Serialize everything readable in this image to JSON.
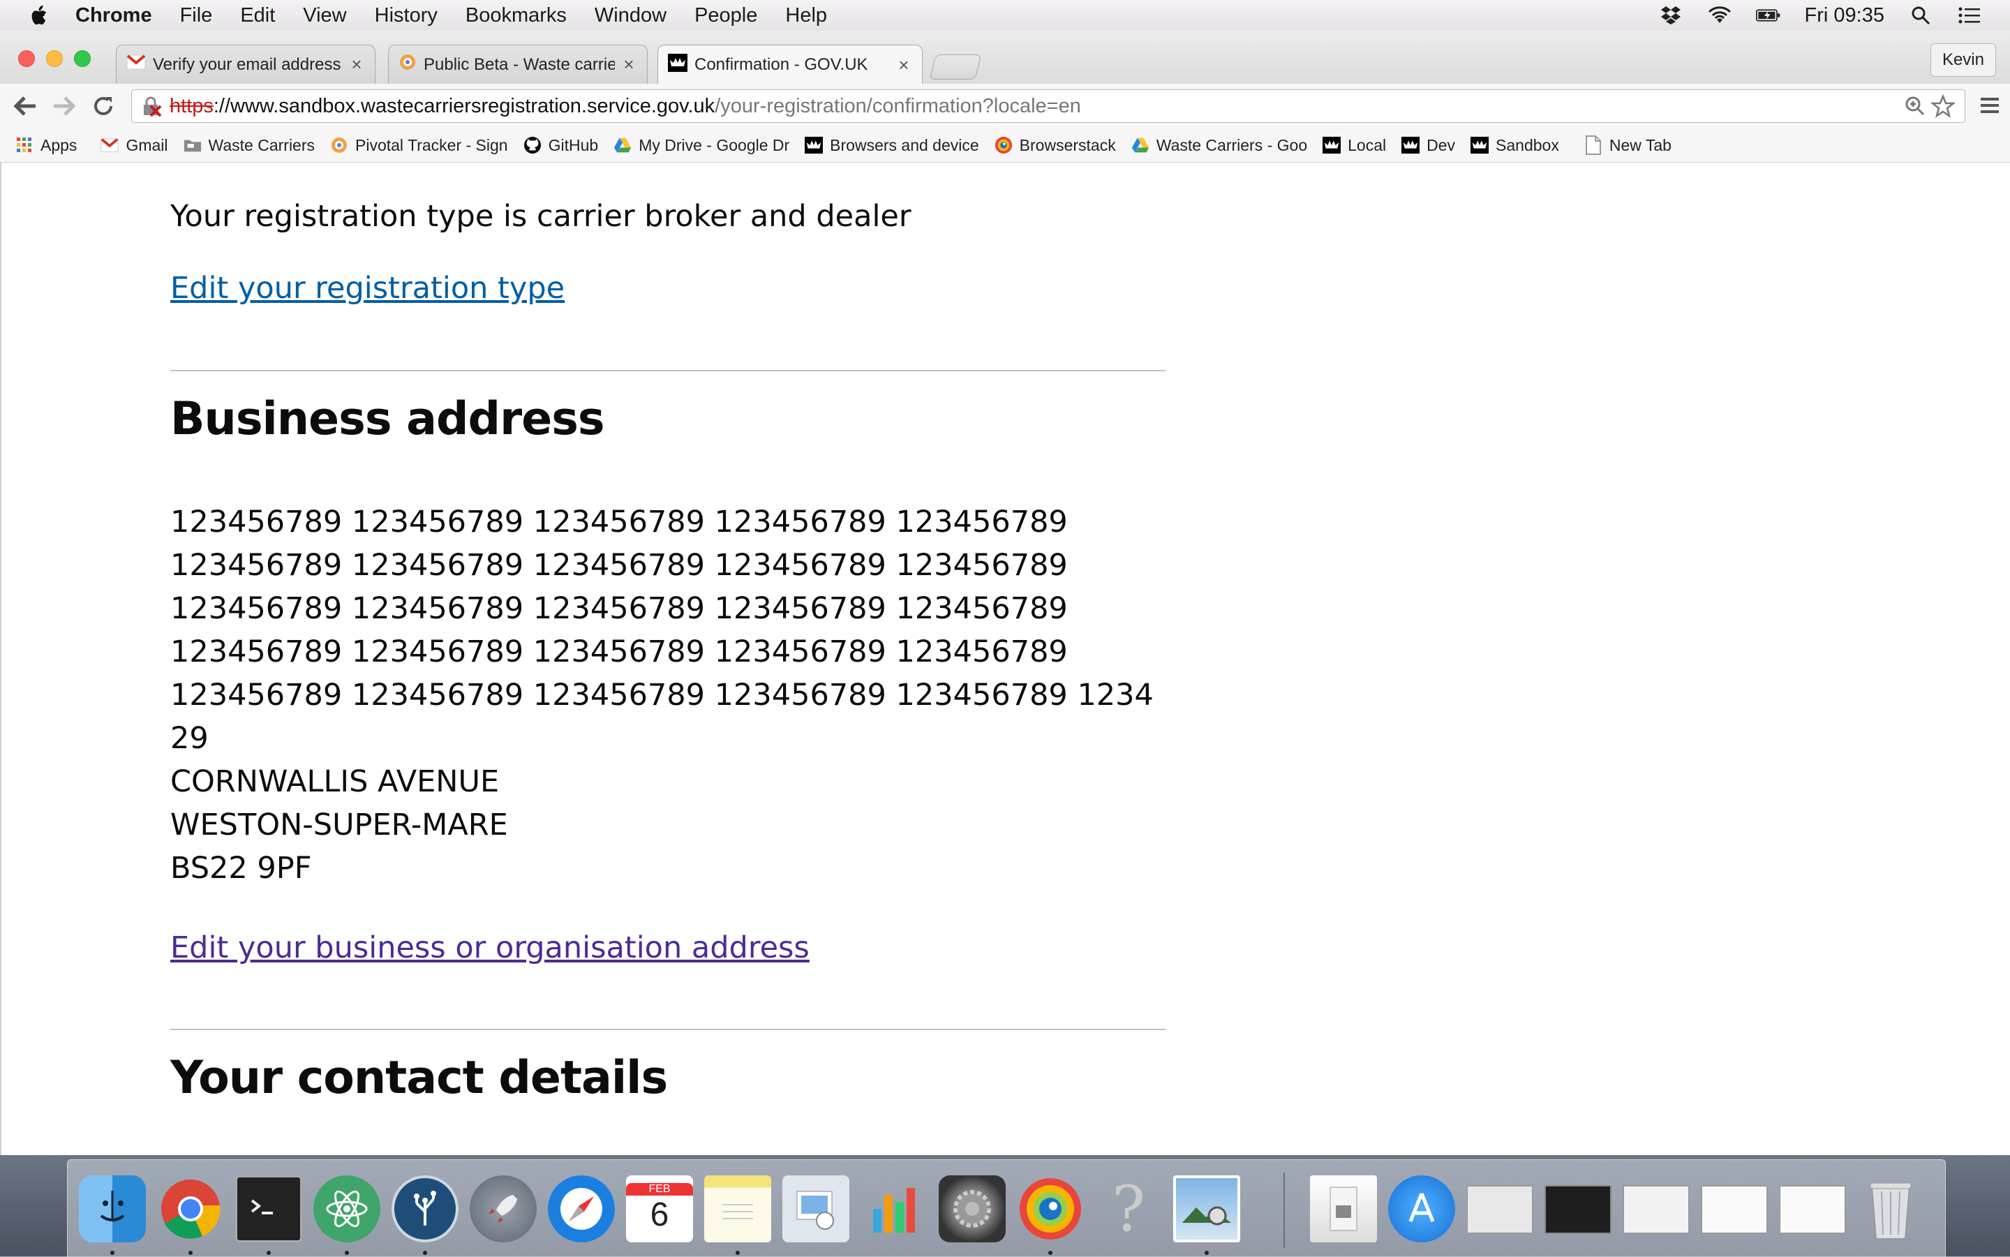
{
  "menubar": {
    "app_name": "Chrome",
    "items": [
      "File",
      "Edit",
      "View",
      "History",
      "Bookmarks",
      "Window",
      "People",
      "Help"
    ],
    "clock": "Fri 09:35"
  },
  "tabs": [
    {
      "title": "Verify your email address -",
      "icon": "gmail-icon",
      "active": false
    },
    {
      "title": "Public Beta - Waste carrier",
      "icon": "pivotal-tracker-icon",
      "active": false
    },
    {
      "title": "Confirmation - GOV.UK",
      "icon": "gov-uk-crown-icon",
      "active": true
    }
  ],
  "tab_close_glyph": "×",
  "profile_name": "Kevin",
  "address_bar": {
    "scheme": "https",
    "host": "://www.sandbox.wastecarriersregistration.service.gov.uk",
    "path": "/your-registration/confirmation?locale=en"
  },
  "bookmarks": [
    {
      "label": "Apps",
      "icon": "apps-grid-icon"
    },
    {
      "label": "Gmail",
      "icon": "gmail-icon"
    },
    {
      "label": "Waste Carriers",
      "icon": "folder-icon"
    },
    {
      "label": "Pivotal Tracker - Sign",
      "icon": "pivotal-tracker-icon"
    },
    {
      "label": "GitHub",
      "icon": "github-icon"
    },
    {
      "label": "My Drive - Google Dr",
      "icon": "google-drive-icon"
    },
    {
      "label": "Browsers and device",
      "icon": "gov-uk-crown-icon"
    },
    {
      "label": "Browserstack",
      "icon": "browserstack-icon"
    },
    {
      "label": "Waste Carriers - Goo",
      "icon": "google-drive-icon"
    },
    {
      "label": "Local",
      "icon": "gov-uk-crown-icon"
    },
    {
      "label": "Dev",
      "icon": "gov-uk-crown-icon"
    },
    {
      "label": "Sandbox",
      "icon": "gov-uk-crown-icon"
    },
    {
      "label": "New Tab",
      "icon": "page-icon"
    }
  ],
  "page": {
    "registration_type_text": "Your registration type is carrier broker and dealer",
    "edit_registration_link": "Edit your registration type",
    "business_address_heading": "Business address",
    "address_lines": [
      "123456789 123456789 123456789 123456789 123456789",
      "123456789 123456789 123456789 123456789 123456789",
      "123456789 123456789 123456789 123456789 123456789",
      "123456789 123456789 123456789 123456789 123456789",
      "123456789 123456789 123456789 123456789 123456789 1234",
      "29",
      "CORNWALLIS AVENUE",
      "WESTON-SUPER-MARE",
      "BS22 9PF"
    ],
    "edit_address_link": "Edit your business or organisation address",
    "contact_details_heading": "Your contact details"
  },
  "dock": {
    "calendar_month": "FEB",
    "calendar_day": "6",
    "help_glyph": "?",
    "apps": [
      "finder",
      "chrome",
      "terminal",
      "atom",
      "sourcetree",
      "launchpad",
      "safari",
      "calendar",
      "notes",
      "preview",
      "numbers",
      "system-preferences",
      "browserstack",
      "help",
      "iphoto"
    ]
  },
  "colors": {
    "link_blue": "#005ea5",
    "link_visited": "#4c2c92",
    "text": "#0b0c0c",
    "insecure_red": "#c51b1b"
  }
}
